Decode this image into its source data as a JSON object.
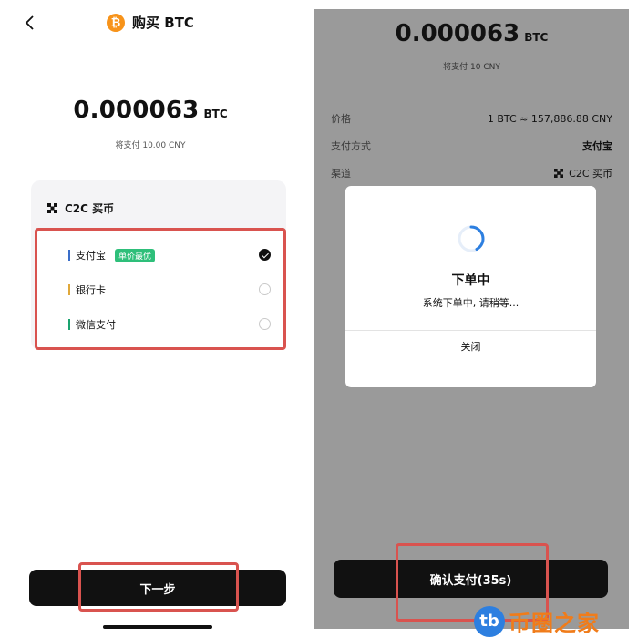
{
  "left": {
    "header": {
      "title": "购买 BTC",
      "coin_glyph": "₿",
      "back_icon": "chevron-left-icon"
    },
    "amount": {
      "value": "0.000063",
      "unit": "BTC"
    },
    "pay_note": "将支付 10.00 CNY",
    "c2c": {
      "title": "C2C 买币",
      "icon": "c2c-icon"
    },
    "methods": [
      {
        "label": "支付宝",
        "tag": "单价最优",
        "bar_color": "#3a6ec9",
        "selected": true
      },
      {
        "label": "银行卡",
        "tag": "",
        "bar_color": "#e0a83a",
        "selected": false
      },
      {
        "label": "微信支付",
        "tag": "",
        "bar_color": "#1aa36f",
        "selected": false
      }
    ],
    "next_button": "下一步"
  },
  "right": {
    "amount": {
      "value": "0.000063",
      "unit": "BTC"
    },
    "pay_note": "将支付 10 CNY",
    "rows": [
      {
        "label": "价格",
        "value": "1 BTC ≈ 157,886.88 CNY"
      },
      {
        "label": "支付方式",
        "value": "支付宝"
      },
      {
        "label": "渠道",
        "value": "C2C 买币"
      }
    ],
    "modal": {
      "title": "下单中",
      "subtitle": "系统下单中, 请稍等...",
      "close": "关闭"
    },
    "confirm_button": "确认支付(35s)"
  },
  "watermark": {
    "badge": "tb",
    "text": "币圈之家"
  },
  "colors": {
    "highlight": "#d9534f",
    "btc_orange": "#f7931a",
    "best_tag": "#2ebf7a",
    "spinner": "#2d7fe0"
  }
}
